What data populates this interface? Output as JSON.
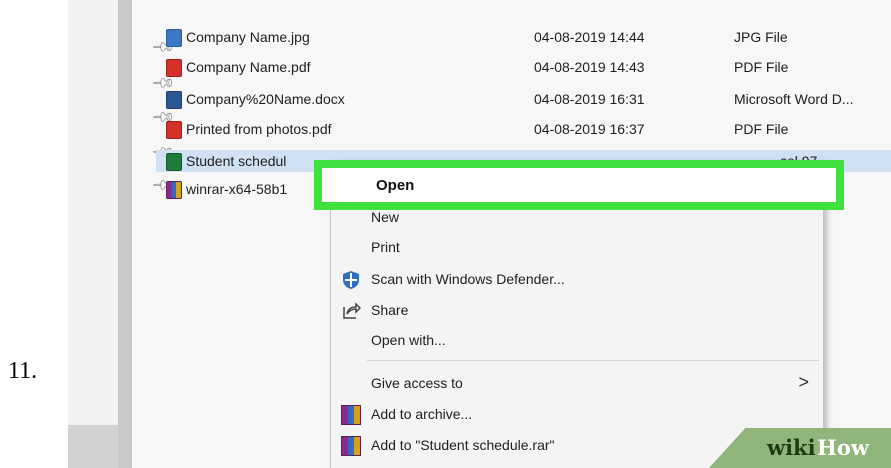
{
  "step_number": "11.",
  "files": [
    {
      "name": "Company Name.jpg",
      "date": "04-08-2019 14:44",
      "type": "JPG File",
      "icon": "image-file-icon",
      "pinned": true
    },
    {
      "name": "Company Name.pdf",
      "date": "04-08-2019 14:43",
      "type": "PDF File",
      "icon": "pdf-file-icon",
      "pinned": true
    },
    {
      "name": "Company%20Name.docx",
      "date": "04-08-2019 16:31",
      "type": "Microsoft Word D...",
      "icon": "word-file-icon",
      "pinned": true
    },
    {
      "name": "Printed from photos.pdf",
      "date": "04-08-2019 16:37",
      "type": "PDF File",
      "icon": "pdf-file-icon",
      "pinned": true
    },
    {
      "name": "Student schedul",
      "date": "",
      "type": "cel 97...",
      "icon": "excel-file-icon",
      "pinned": true,
      "selected": true
    },
    {
      "name": "winrar-x64-58b1",
      "date": "",
      "type": "",
      "icon": "winrar-icon",
      "pinned": true
    }
  ],
  "context_menu": {
    "open": "Open",
    "new_partial": "New",
    "print": "Print",
    "scan": "Scan with Windows Defender...",
    "share": "Share",
    "open_with": "Open with...",
    "give_access": "Give access to",
    "give_access_arrow": ">",
    "add_archive": "Add to archive...",
    "add_rar": "Add to \"Student schedule.rar\""
  },
  "watermark": {
    "wiki": "wiki",
    "how": "How"
  },
  "colors": {
    "highlight": "#3fe13f",
    "selection": "#cfe1f3",
    "watermark_bg": "#8fb57a"
  }
}
